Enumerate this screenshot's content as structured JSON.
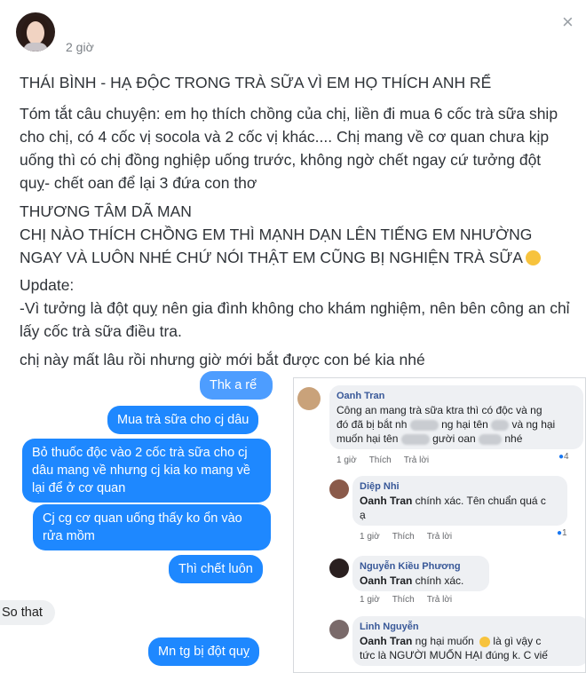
{
  "post": {
    "time": "2 giờ",
    "title": "THÁI BÌNH - HẠ ĐỘC TRONG TRÀ SỮA VÌ EM HỌ THÍCH ANH RỂ",
    "summary": "Tóm tắt câu chuyện: em họ thích chồng của chị, liền đi mua 6 cốc trà sữa ship cho chị, có 4 cốc vị socola và 2 cốc vị khác.... Chị mang về cơ quan chưa kịp uống thì có chị đồng nghiệp uống trước, không ngờ chết ngay cứ tưởng đột quỵ- chết oan để lại 3 đứa con thơ",
    "shout_1": "THƯƠNG TÂM DÃ MAN",
    "shout_2": "CHỊ NÀO THÍCH CHỒNG EM THÌ MẠNH DẠN LÊN TIẾNG EM NHƯỜNG NGAY VÀ LUÔN NHÉ CHỨ NÓI THẬT EM CŨNG BỊ NGHIỆN TRÀ SỮA",
    "update_label": "Update:",
    "update_text": "-Vì tưởng là đột quỵ nên gia đình không cho khám nghiệm, nên bên công an chỉ lấy cốc trà sữa điều tra.",
    "closing": "chị này mất lâu rồi nhưng giờ mới bắt được con bé kia nhé"
  },
  "chat": {
    "partial_top": "Thk a rể",
    "m1": "Mua trà sữa cho cj dâu",
    "m2": "Bỏ thuốc độc vào 2 cốc trà sữa cho cj dâu mang về nhưng cj kia ko mang về lại để ở cơ quan",
    "m3": "Cj cg cơ quan uống thấy ko ổn vào rửa mồm",
    "m4": "Thì chết luôn",
    "received": "So that",
    "m5": "Mn tg bị đột quỵ"
  },
  "comments": {
    "actions": {
      "like": "Thích",
      "reply": "Trả lời",
      "time": "1 giờ"
    },
    "c1": {
      "name": "Oanh Tran",
      "text_a": "Công an mang trà sữa ktra thì có độc và ng",
      "text_b": "đó đã bị bắt nh",
      "text_c": "ng hại tên",
      "text_d": "và ng hại",
      "text_e": "muốn hại tên",
      "text_f": "gười oan",
      "text_g": "nhé",
      "reactions": "4"
    },
    "c2": {
      "name": "Diệp Nhi",
      "mention": "Oanh Tran",
      "text": " chính xác. Tên chuẩn quá c",
      "text2": "ạ",
      "reactions": "1"
    },
    "c3": {
      "name": "Nguyễn Kiều Phương",
      "mention": "Oanh Tran",
      "text": " chính xác."
    },
    "c4": {
      "name": "Linh Nguyễn",
      "mention": "Oanh Tran",
      "text": " ng hại muốn",
      "text2": " là gì vậy c",
      "text3": "tức là NGƯỜI MUỐN HẠI đúng k. C viế"
    }
  },
  "icons": {
    "close": "close-icon",
    "emoji": "relieved-face-emoji"
  }
}
